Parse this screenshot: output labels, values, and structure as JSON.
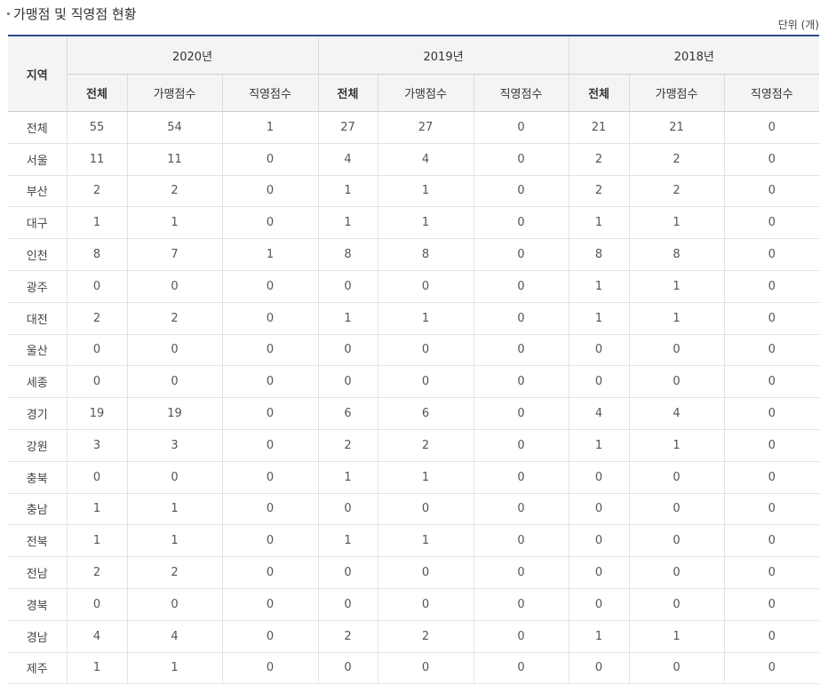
{
  "section": {
    "title": "가맹점 및 직영점 현황",
    "unit": "단위 (개)"
  },
  "table": {
    "region_header": "지역",
    "years": [
      "2020년",
      "2019년",
      "2018년"
    ],
    "sub_headers": [
      "전체",
      "가맹점수",
      "직영점수"
    ],
    "rows": [
      {
        "region": "전체",
        "values": [
          "55",
          "54",
          "1",
          "27",
          "27",
          "0",
          "21",
          "21",
          "0"
        ]
      },
      {
        "region": "서울",
        "values": [
          "11",
          "11",
          "0",
          "4",
          "4",
          "0",
          "2",
          "2",
          "0"
        ]
      },
      {
        "region": "부산",
        "values": [
          "2",
          "2",
          "0",
          "1",
          "1",
          "0",
          "2",
          "2",
          "0"
        ]
      },
      {
        "region": "대구",
        "values": [
          "1",
          "1",
          "0",
          "1",
          "1",
          "0",
          "1",
          "1",
          "0"
        ]
      },
      {
        "region": "인천",
        "values": [
          "8",
          "7",
          "1",
          "8",
          "8",
          "0",
          "8",
          "8",
          "0"
        ]
      },
      {
        "region": "광주",
        "values": [
          "0",
          "0",
          "0",
          "0",
          "0",
          "0",
          "1",
          "1",
          "0"
        ]
      },
      {
        "region": "대전",
        "values": [
          "2",
          "2",
          "0",
          "1",
          "1",
          "0",
          "1",
          "1",
          "0"
        ]
      },
      {
        "region": "울산",
        "values": [
          "0",
          "0",
          "0",
          "0",
          "0",
          "0",
          "0",
          "0",
          "0"
        ]
      },
      {
        "region": "세종",
        "values": [
          "0",
          "0",
          "0",
          "0",
          "0",
          "0",
          "0",
          "0",
          "0"
        ]
      },
      {
        "region": "경기",
        "values": [
          "19",
          "19",
          "0",
          "6",
          "6",
          "0",
          "4",
          "4",
          "0"
        ]
      },
      {
        "region": "강원",
        "values": [
          "3",
          "3",
          "0",
          "2",
          "2",
          "0",
          "1",
          "1",
          "0"
        ]
      },
      {
        "region": "충북",
        "values": [
          "0",
          "0",
          "0",
          "1",
          "1",
          "0",
          "0",
          "0",
          "0"
        ]
      },
      {
        "region": "충남",
        "values": [
          "1",
          "1",
          "0",
          "0",
          "0",
          "0",
          "0",
          "0",
          "0"
        ]
      },
      {
        "region": "전북",
        "values": [
          "1",
          "1",
          "0",
          "1",
          "1",
          "0",
          "0",
          "0",
          "0"
        ]
      },
      {
        "region": "전남",
        "values": [
          "2",
          "2",
          "0",
          "0",
          "0",
          "0",
          "0",
          "0",
          "0"
        ]
      },
      {
        "region": "경북",
        "values": [
          "0",
          "0",
          "0",
          "0",
          "0",
          "0",
          "0",
          "0",
          "0"
        ]
      },
      {
        "region": "경남",
        "values": [
          "4",
          "4",
          "0",
          "2",
          "2",
          "0",
          "1",
          "1",
          "0"
        ]
      },
      {
        "region": "제주",
        "values": [
          "1",
          "1",
          "0",
          "0",
          "0",
          "0",
          "0",
          "0",
          "0"
        ]
      }
    ]
  }
}
